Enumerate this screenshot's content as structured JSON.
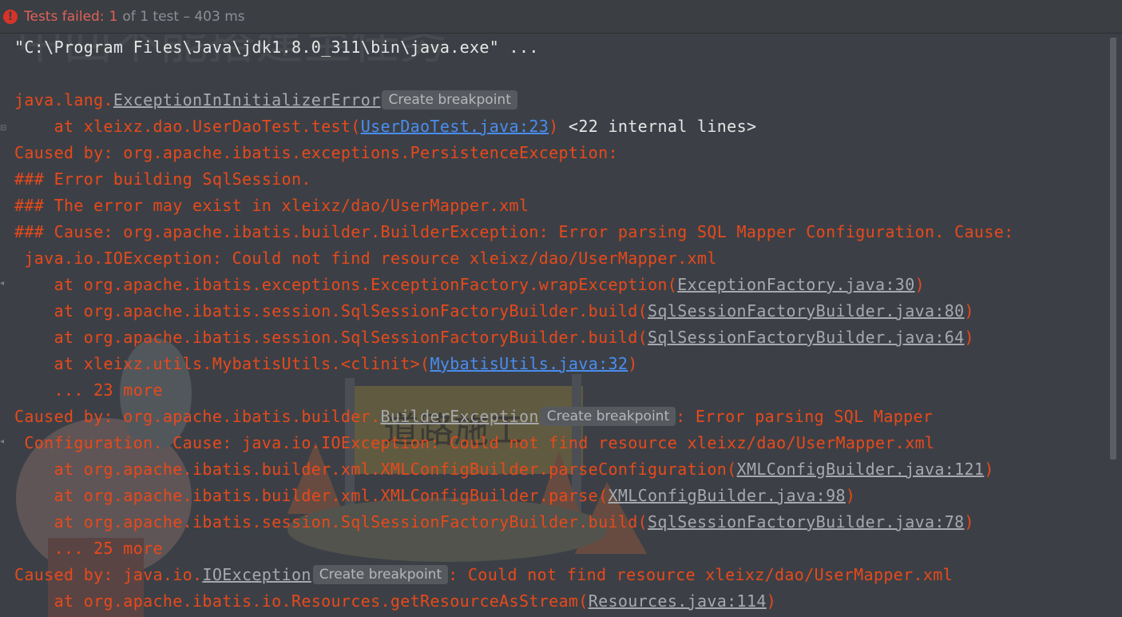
{
  "header": {
    "status_prefix": "Tests failed:",
    "failed_count": "1",
    "summary": "of 1 test – 403 ms"
  },
  "console": {
    "cmd": "\"C:\\Program Files\\Java\\jdk1.8.0_311\\bin\\java.exe\" ...",
    "l1_pkg": "java.lang.",
    "l1_exc": "ExceptionInInitializerError",
    "bp_label": "Create breakpoint",
    "l2_at": "    at xleixz.dao.UserDaoTest.test(",
    "l2_link": "UserDaoTest.java:23",
    "l2_tail": ") ",
    "l2_internal": "<22 internal lines>",
    "l3": "Caused by: org.apache.ibatis.exceptions.PersistenceException:",
    "l4": "### Error building SqlSession.",
    "l5": "### The error may exist in xleixz/dao/UserMapper.xml",
    "l6": "### Cause: org.apache.ibatis.builder.BuilderException: Error parsing SQL Mapper Configuration. Cause:",
    "l7": " java.io.IOException: Could not find resource xleixz/dao/UserMapper.xml",
    "l8_at": "    at org.apache.ibatis.exceptions.ExceptionFactory.wrapException(",
    "l8_link": "ExceptionFactory.java:30",
    "l9_at": "    at org.apache.ibatis.session.SqlSessionFactoryBuilder.build(",
    "l9_link": "SqlSessionFactoryBuilder.java:80",
    "l10_at": "    at org.apache.ibatis.session.SqlSessionFactoryBuilder.build(",
    "l10_link": "SqlSessionFactoryBuilder.java:64",
    "l11_at": "    at xleixz.utils.MybatisUtils.<clinit>(",
    "l11_link": "MybatisUtils.java:32",
    "l12": "    ... 23 more",
    "l13_pre": "Caused by: org.apache.ibatis.builder.",
    "l13_exc": "BuilderException",
    "l13_post": ": Error parsing SQL Mapper",
    "l14": " Configuration. Cause: java.io.IOException: Could not find resource xleixz/dao/UserMapper.xml",
    "l15_at": "    at org.apache.ibatis.builder.xml.XMLConfigBuilder.parseConfiguration(",
    "l15_link": "XMLConfigBuilder.java:121",
    "l16_at": "    at org.apache.ibatis.builder.xml.XMLConfigBuilder.parse(",
    "l16_link": "XMLConfigBuilder.java:98",
    "l17_at": "    at org.apache.ibatis.session.SqlSessionFactoryBuilder.build(",
    "l17_link": "SqlSessionFactoryBuilder.java:78",
    "l18": "    ... 25 more",
    "l19_pre": "Caused by: java.io.",
    "l19_exc": "IOException",
    "l19_post": ": Could not find resource xleixz/dao/UserMapper.xml",
    "l20_at": "    at org.apache.ibatis.io.Resources.getResourceAsStream(",
    "l20_link": "Resources.java:114",
    "close": ")"
  },
  "background_text": "道路施工",
  "colors": {
    "error_text": "#e8491b",
    "link_blue": "#4a8df0",
    "background": "#3c4046"
  }
}
